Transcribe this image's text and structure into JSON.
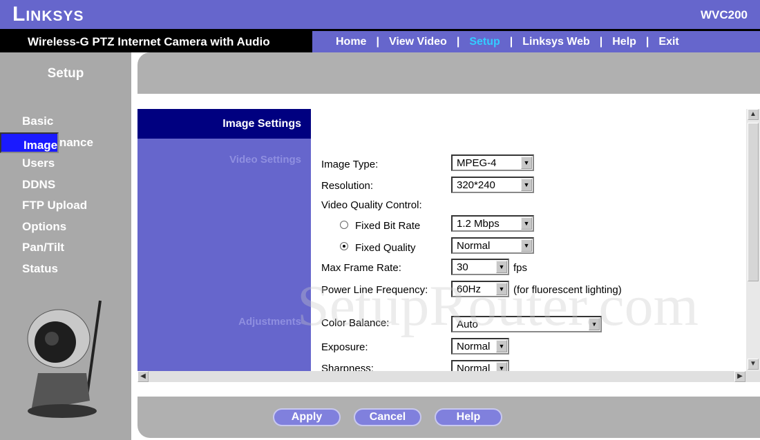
{
  "header": {
    "logo": "Linksys",
    "model": "WVC200",
    "product": "Wireless-G PTZ Internet Camera with Audio"
  },
  "nav": [
    {
      "label": "Home"
    },
    {
      "label": "View Video"
    },
    {
      "label": "Setup",
      "active": true
    },
    {
      "label": "Linksys Web"
    },
    {
      "label": "Help"
    },
    {
      "label": "Exit"
    }
  ],
  "sidebar": {
    "title": "Setup",
    "items": [
      {
        "label": "Basic"
      },
      {
        "label": "Image",
        "selected": true
      },
      {
        "label": "Maintenance"
      },
      {
        "label": "Users"
      },
      {
        "label": "DDNS"
      },
      {
        "label": "FTP Upload"
      },
      {
        "label": "Options"
      },
      {
        "label": "Pan/Tilt"
      },
      {
        "label": "Status"
      }
    ]
  },
  "main": {
    "section_title": "Image Settings",
    "video_settings": "Video Settings",
    "adjustments": "Adjustments",
    "fields": {
      "image_type": {
        "label": "Image Type:",
        "value": "MPEG-4"
      },
      "resolution": {
        "label": "Resolution:",
        "value": "320*240"
      },
      "vqc": {
        "label": "Video Quality Control:"
      },
      "fixed_bit_rate": {
        "label": "Fixed Bit Rate",
        "value": "1.2 Mbps",
        "checked": false
      },
      "fixed_quality": {
        "label": "Fixed Quality",
        "value": "Normal",
        "checked": true
      },
      "max_frame_rate": {
        "label": "Max Frame Rate:",
        "value": "30",
        "unit": "fps"
      },
      "power_line": {
        "label": "Power Line Frequency:",
        "value": "60Hz",
        "note": "(for fluorescent lighting)"
      },
      "color_balance": {
        "label": "Color Balance:",
        "value": "Auto"
      },
      "exposure": {
        "label": "Exposure:",
        "value": "Normal"
      },
      "sharpness": {
        "label": "Sharpness:",
        "value": "Normal"
      }
    }
  },
  "footer": {
    "apply": "Apply",
    "cancel": "Cancel",
    "help": "Help"
  },
  "watermark": "SetupRouter.com"
}
